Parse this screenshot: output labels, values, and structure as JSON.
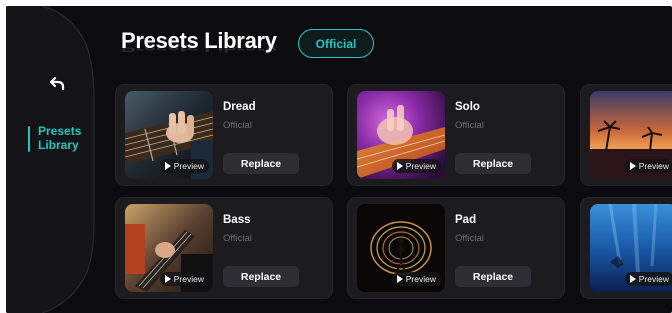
{
  "sidebar": {
    "back_icon": "back-arrow-icon",
    "active_item": "Presets\nLibrary",
    "accent": "#27c4c0"
  },
  "header": {
    "title": "Presets Library",
    "filter_pill": "Official"
  },
  "presets": [
    {
      "name": "Dread",
      "source": "Official",
      "preview_label": "Preview",
      "action_label": "Replace"
    },
    {
      "name": "Solo",
      "source": "Official",
      "preview_label": "Preview",
      "action_label": "Replace"
    },
    {
      "name": "Bass",
      "source": "Official",
      "preview_label": "Preview",
      "action_label": "Replace"
    },
    {
      "name": "Pad",
      "source": "Official",
      "preview_label": "Preview",
      "action_label": "Replace"
    }
  ],
  "partial_presets": [
    {
      "preview_label": "Preview"
    },
    {
      "preview_label": "Preview"
    }
  ],
  "colors": {
    "background": "#0c0c0e",
    "card": "#1c1c1f",
    "button": "#2d2d33",
    "subtext": "#6c6c72"
  }
}
